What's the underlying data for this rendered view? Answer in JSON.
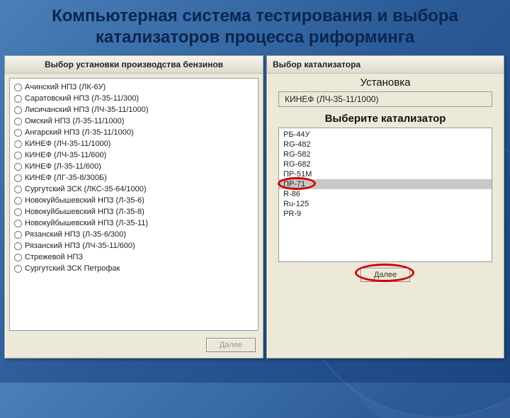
{
  "title": "Компьютерная система тестирования и выбора катализаторов процесса риформинга",
  "left": {
    "header": "Выбор установки производства бензинов",
    "plants": [
      "Ачинский НПЗ (ЛК-6У)",
      "Саратовский НПЗ (Л-35-11/300)",
      "Лисичанский НПЗ (ЛЧ-35-11/1000)",
      "Омский НПЗ (Л-35-11/1000)",
      "Ангарский НПЗ (Л-35-11/1000)",
      "КИНЕФ (ЛЧ-35-11/1000)",
      "КИНЕФ (ЛЧ-35-11/600)",
      "КИНЕФ (Л-35-11/600)",
      "КИНЕФ (ЛГ-35-8/300Б)",
      "Сургутский ЗСК (ЛКС-35-64/1000)",
      "Новокуйбышевский НПЗ (Л-35-6)",
      "Новокуйбышевский НПЗ (Л-35-8)",
      "Новокуйбышевский НПЗ (Л-35-11)",
      "Рязанский НПЗ (Л-35-6/300)",
      "Рязанский НПЗ (ЛЧ-35-11/600)",
      "Стрежевой НПЗ",
      "Сургутский ЗСК Петрофак"
    ],
    "next": "Далее"
  },
  "right": {
    "header": "Выбор катализатора",
    "plant_label": "Установка",
    "plant_value": "КИНЕФ (ЛЧ-35-11/1000)",
    "choose_label": "Выберите катализатор",
    "catalysts": [
      "РБ-44У",
      "RG-482",
      "RG-582",
      "RG-682",
      "ПР-51М",
      "ПР-71",
      "R-86",
      "Ru-125",
      "PR-9"
    ],
    "selected_index": 5,
    "next": "Далее"
  }
}
